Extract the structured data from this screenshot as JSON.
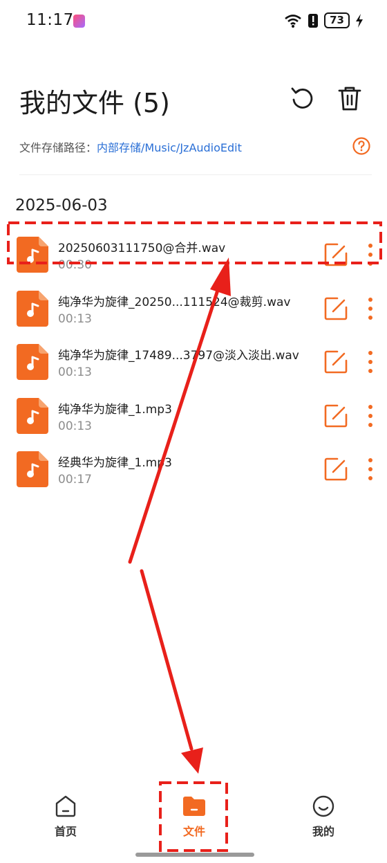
{
  "status_bar": {
    "time": "11:17",
    "battery": "73",
    "icons": [
      "app-badge-icon",
      "wifi-icon",
      "alert-icon",
      "battery-icon",
      "charging-icon"
    ]
  },
  "header": {
    "title": "我的文件 (5)",
    "refresh_icon": "refresh-icon",
    "delete_icon": "trash-icon"
  },
  "storage": {
    "label": "文件存储路径：",
    "path": "内部存储/Music/JzAudioEdit",
    "help_icon": "help-icon"
  },
  "date_group": "2025-06-03",
  "files": [
    {
      "name": "20250603111750@合并.wav",
      "duration": "00:30"
    },
    {
      "name": "纯净华为旋律_20250...111524@裁剪.wav",
      "duration": "00:13"
    },
    {
      "name": "纯净华为旋律_17489...3797@淡入淡出.wav",
      "duration": "00:13"
    },
    {
      "name": "纯净华为旋律_1.mp3",
      "duration": "00:13"
    },
    {
      "name": "经典华为旋律_1.mp3",
      "duration": "00:17"
    }
  ],
  "nav": {
    "home": "首页",
    "files": "文件",
    "mine": "我的",
    "active": "files"
  },
  "colors": {
    "accent": "#f26a22",
    "link": "#2a6fd6",
    "annotation": "#e8201a"
  }
}
